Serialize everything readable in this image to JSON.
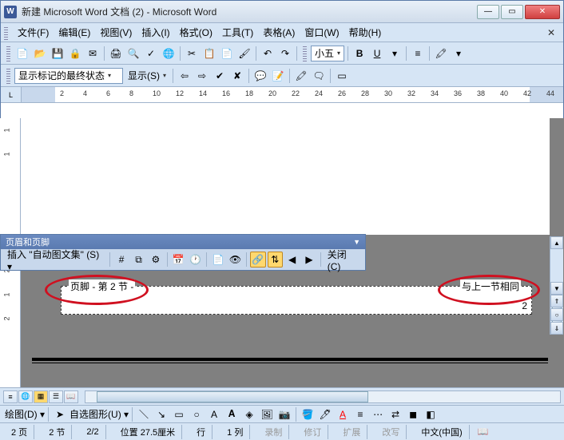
{
  "window": {
    "title": "新建 Microsoft Word 文档 (2) - Microsoft Word",
    "app_icon": "W"
  },
  "menu": {
    "file": "文件(F)",
    "edit": "编辑(E)",
    "view": "视图(V)",
    "insert": "插入(I)",
    "format": "格式(O)",
    "tools": "工具(T)",
    "table": "表格(A)",
    "window": "窗口(W)",
    "help": "帮助(H)"
  },
  "font": {
    "size_label": "小五",
    "bold": "B",
    "underline": "U"
  },
  "review": {
    "state": "显示标记的最终状态",
    "show": "显示(S)"
  },
  "ruler": {
    "corner": "L",
    "nums": [
      "2",
      "4",
      "6",
      "8",
      "10",
      "12",
      "14",
      "16",
      "18",
      "20",
      "22",
      "24",
      "26",
      "28",
      "30",
      "32",
      "34",
      "36",
      "38",
      "40",
      "42",
      "44"
    ]
  },
  "vruler": {
    "nums": [
      "1",
      "1",
      "2",
      "1",
      "2"
    ]
  },
  "hf": {
    "title": "页眉和页脚",
    "insert_auto": "插入 \"自动图文集\" (S)",
    "close": "关闭(C)"
  },
  "footer": {
    "left_label": "页脚 - 第 2 节 -",
    "right_label": "与上一节相同",
    "page_num": "2"
  },
  "draw": {
    "label": "绘图(D)",
    "autoshape": "自选图形(U)"
  },
  "status": {
    "page": "2 页",
    "sec": "2 节",
    "pages": "2/2",
    "pos": "位置 27.5厘米",
    "line": "行",
    "col": "1 列",
    "rec": "录制",
    "rev": "修订",
    "ext": "扩展",
    "ovr": "改写",
    "lang": "中文(中国)"
  }
}
